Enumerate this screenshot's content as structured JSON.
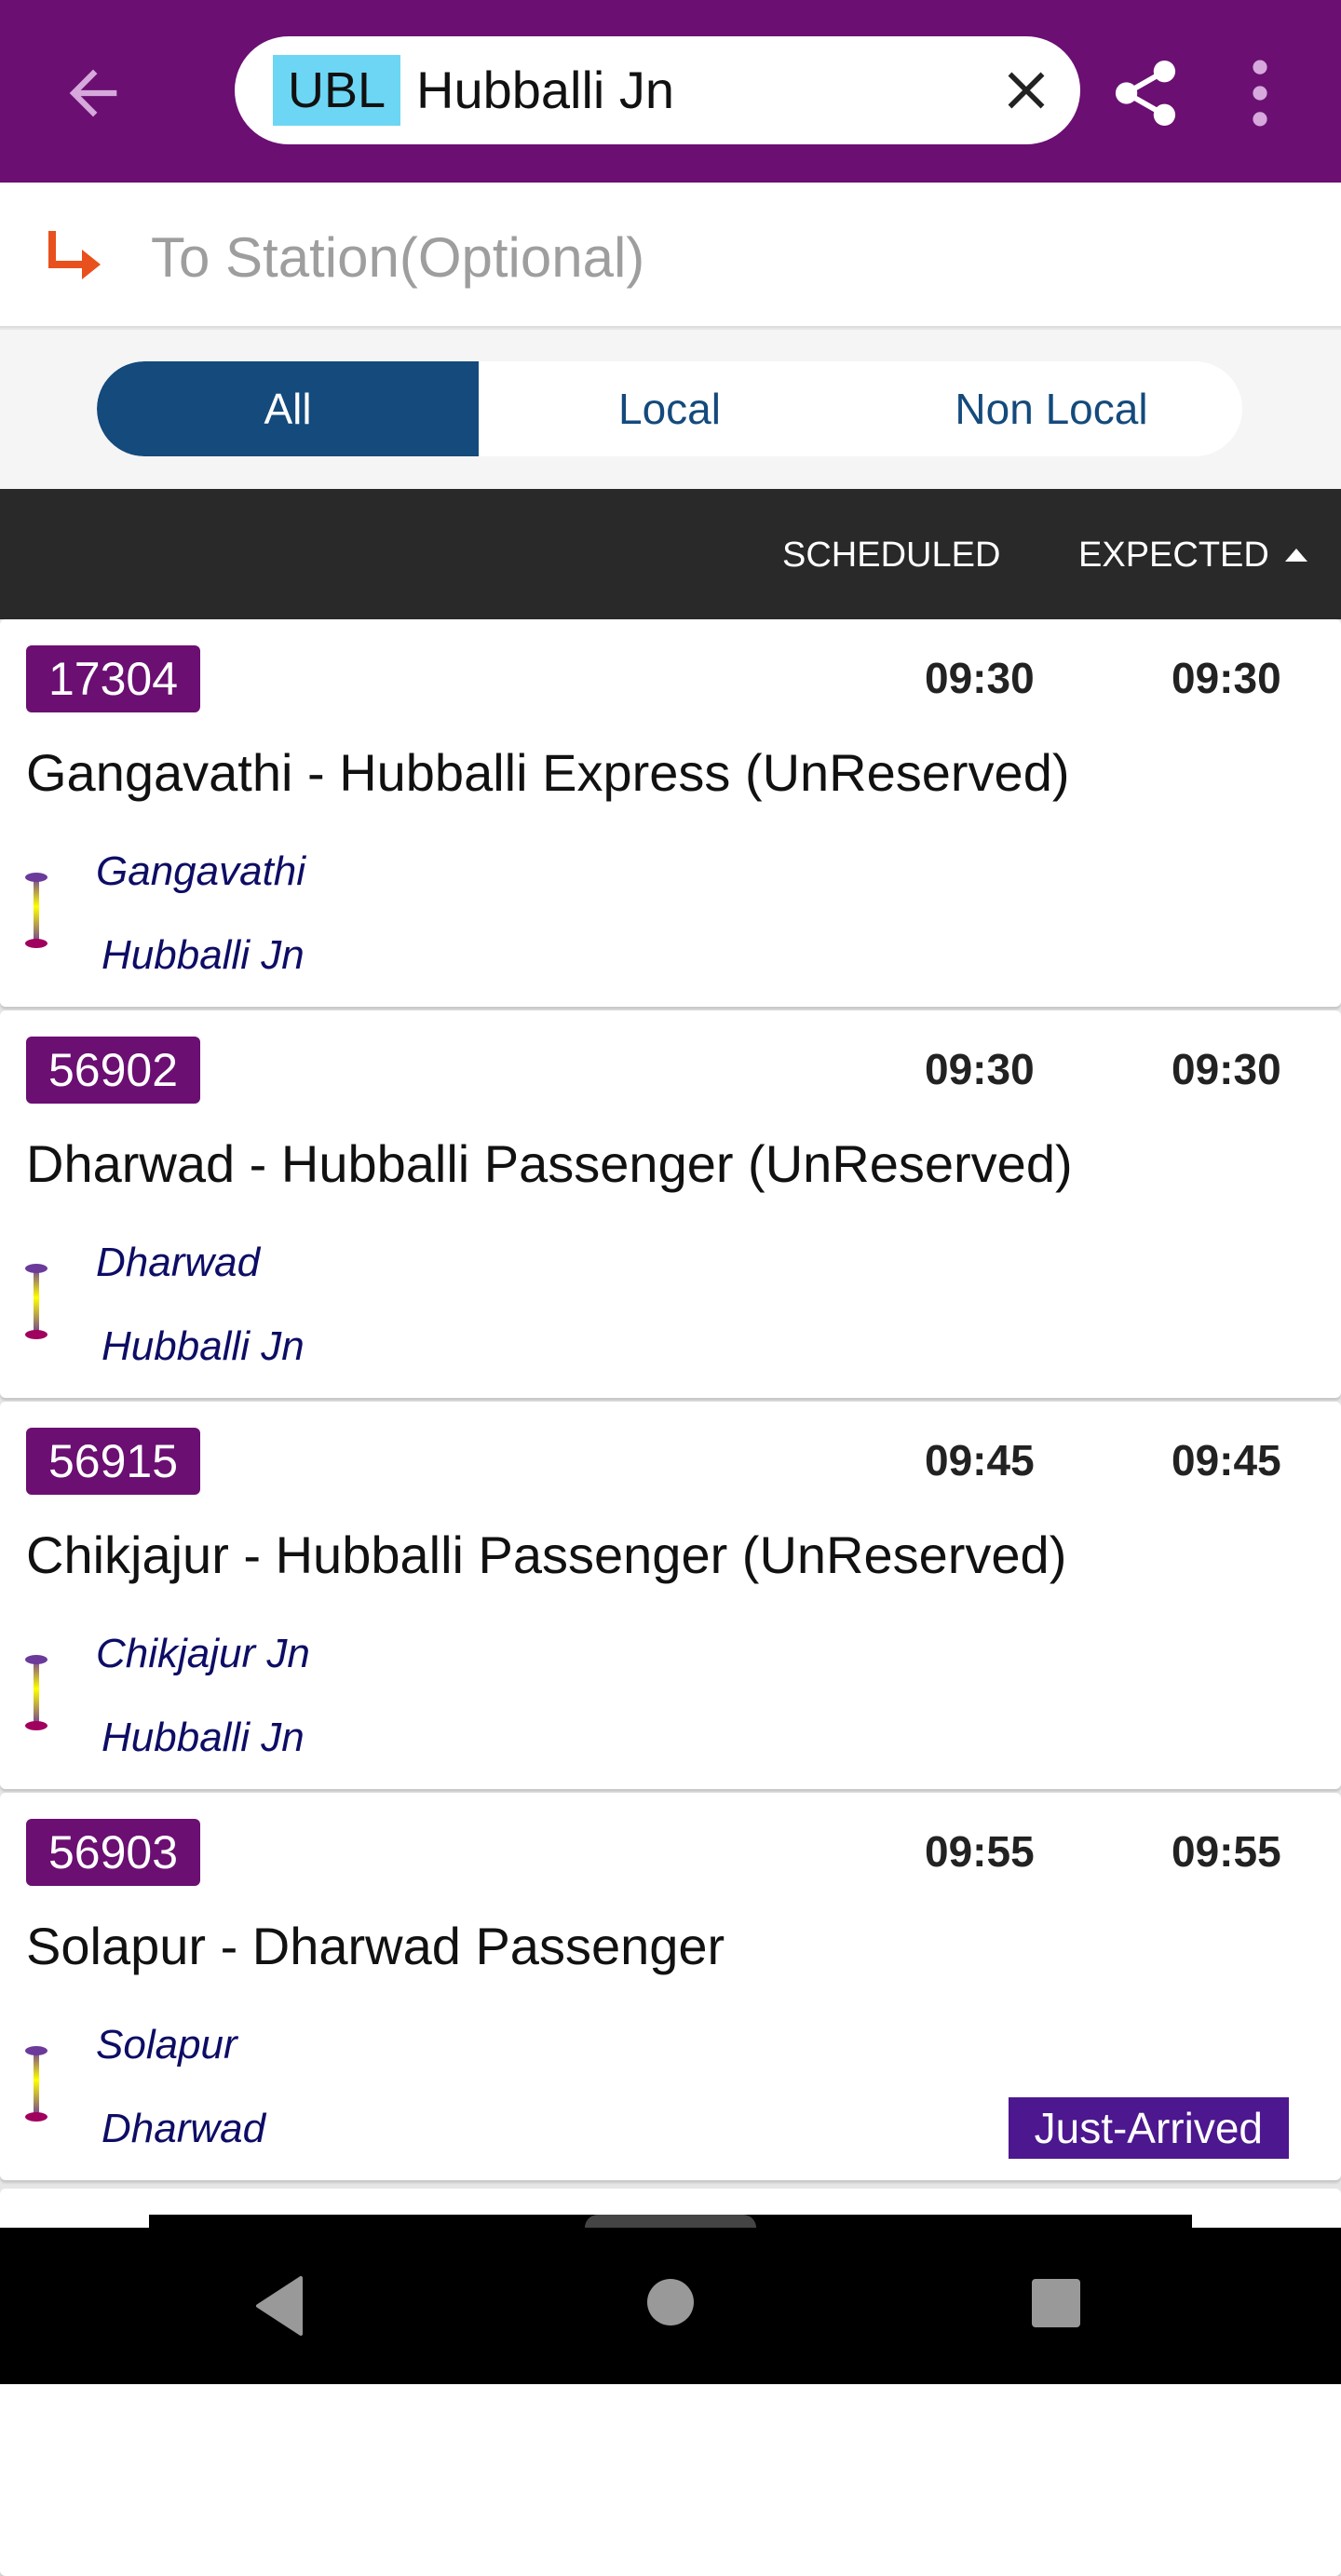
{
  "appbar": {
    "station_code": "UBL",
    "station_name": "Hubballi Jn",
    "accent": "#6b0f72"
  },
  "to_station": {
    "placeholder": "To Station(Optional)"
  },
  "filter": {
    "tabs": [
      "All",
      "Local",
      "Non Local"
    ],
    "selected": "All"
  },
  "columns": {
    "scheduled": "SCHEDULED",
    "expected": "EXPECTED",
    "sort": "ascending"
  },
  "trains": [
    {
      "number": "17304",
      "scheduled": "09:30",
      "expected": "09:30",
      "name": "Gangavathi - Hubballi Express (UnReserved)",
      "from": "Gangavathi",
      "to": "Hubballi Jn",
      "status": ""
    },
    {
      "number": "56902",
      "scheduled": "09:30",
      "expected": "09:30",
      "name": "Dharwad - Hubballi Passenger (UnReserved)",
      "from": "Dharwad",
      "to": "Hubballi Jn",
      "status": ""
    },
    {
      "number": "56915",
      "scheduled": "09:45",
      "expected": "09:45",
      "name": "Chikjajur - Hubballi Passenger (UnReserved)",
      "from": "Chikjajur Jn",
      "to": "Hubballi Jn",
      "status": ""
    },
    {
      "number": "56903",
      "scheduled": "09:55",
      "expected": "09:55",
      "name": "Solapur - Dharwad Passenger",
      "from": "Solapur",
      "to": "Dharwad",
      "status": "Just-Arrived"
    }
  ]
}
